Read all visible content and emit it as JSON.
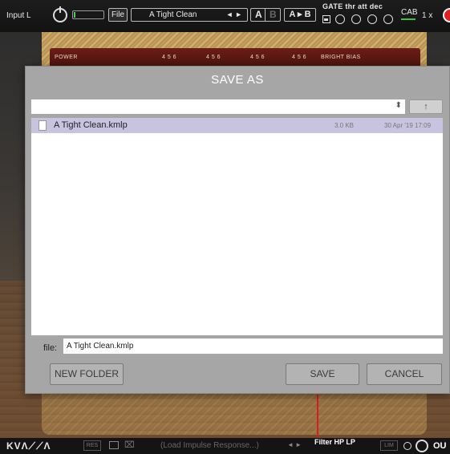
{
  "topbar": {
    "input_label": "Input L",
    "file_button": "File",
    "preset_name": "A Tight Clean",
    "preset_arrows": "◄ ►",
    "ab_a": "A",
    "ab_b": "B",
    "a_to_b": "A ▸ B",
    "gate_label": "GATE thr att dec",
    "cab_label": "CAB",
    "zoom_label": "1 x"
  },
  "amp_panel": {
    "labels": [
      "POWER",
      "4 5 6",
      "4 5 6",
      "4 5 6",
      "4 5 6",
      "BRIGHT BIAS"
    ]
  },
  "dialog": {
    "title": "SAVE AS",
    "path_value": "",
    "up_icon": "↑",
    "files": [
      {
        "name": "A Tight Clean.kmlp",
        "size": "3.0 KB",
        "date": "30 Apr '19 17:09",
        "selected": true
      }
    ],
    "file_label": "file:",
    "file_value": "A Tight Clean.kmlp",
    "new_folder_label": "NEW FOLDER",
    "save_label": "SAVE",
    "cancel_label": "CANCEL"
  },
  "botbar": {
    "logo": "KVΛ⟋⟋Λ",
    "res_label": "RES",
    "load_label": "(Load Impulse Response...)",
    "arrows": "◄ ►",
    "filter_label": "Filter HP LP",
    "lim_label": "LIM",
    "out_label": "OU"
  }
}
